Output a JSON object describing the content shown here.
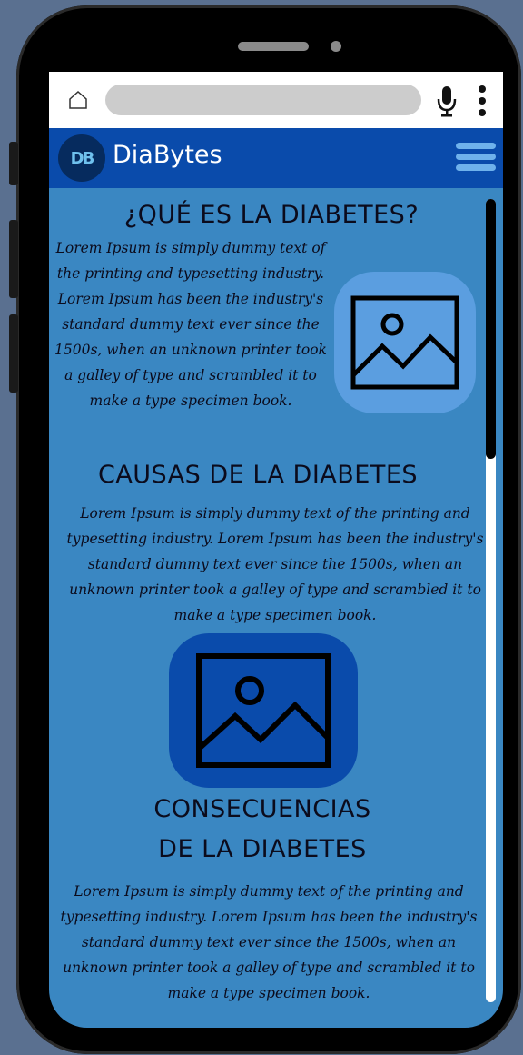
{
  "browser": {
    "home_icon": "home-icon",
    "mic_icon": "microphone-icon",
    "menu_icon": "vertical-dots-icon"
  },
  "app": {
    "logo_text": "DB",
    "title": "DiaBytes",
    "menu_icon": "hamburger-menu-icon"
  },
  "sections": [
    {
      "heading": "¿QUÉ ES LA DIABETES?",
      "text": "Lorem Ipsum is simply dummy text of the printing and typesetting industry. Lorem Ipsum has been the industry's standard dummy text ever since the 1500s, when an unknown printer took a galley of type and scrambled it to make a type specimen book.",
      "image_icon": "image-placeholder-icon"
    },
    {
      "heading": "CAUSAS DE LA DIABETES",
      "text": "Lorem Ipsum is simply dummy text of the printing and typesetting industry. Lorem Ipsum has been the industry's standard dummy text ever since the 1500s, when an unknown printer took a galley of type and scrambled it to make a type specimen book.",
      "image_icon": "image-placeholder-icon"
    },
    {
      "heading_line1": "CONSECUENCIAS",
      "heading_line2": "DE LA DIABETES",
      "text": "Lorem Ipsum is simply dummy text of the printing and typesetting industry. Lorem Ipsum has been the industry's standard dummy text ever since the 1500s, when an unknown printer took a galley of type and scrambled it to make a type specimen book."
    }
  ],
  "colors": {
    "header": "#0a4bab",
    "content_bg": "#3a87c2",
    "image_box_light": "#5b9ee0",
    "image_box_dark": "#0a4bab"
  }
}
